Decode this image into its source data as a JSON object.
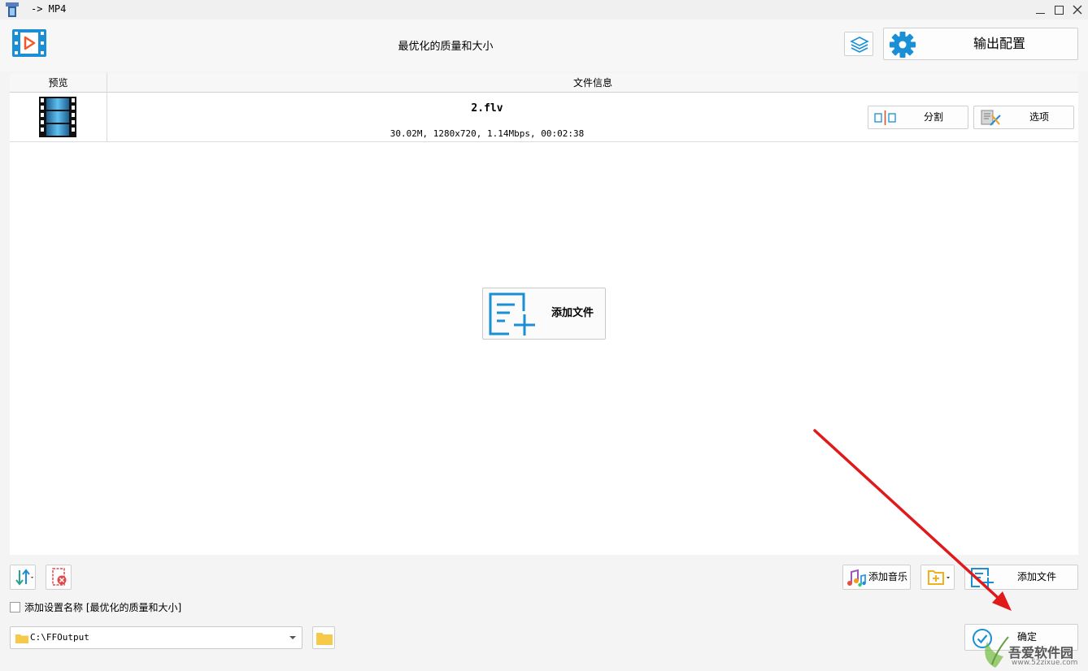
{
  "window": {
    "title": "-> MP4",
    "minimize_glyph": "—",
    "maximize_glyph": "☐",
    "close_glyph": "✕"
  },
  "toolbar": {
    "preset_title": "最优化的质量和大小",
    "output_config_label": "输出配置"
  },
  "table": {
    "columns": [
      "预览",
      "文件信息"
    ],
    "rows": [
      {
        "filename": "2.flv",
        "info": "30.02M, 1280x720, 1.14Mbps, 00:02:38",
        "split_label": "分割",
        "options_label": "选项"
      }
    ]
  },
  "center": {
    "add_file_label": "添加文件"
  },
  "bottom": {
    "add_music_label": "添加音乐",
    "add_file_label": "添加文件",
    "checkbox_label": "添加设置名称 [最优化的质量和大小]",
    "checkbox_checked": false,
    "output_path": "C:\\FFOutput",
    "ok_label": "确定"
  },
  "watermark": {
    "site_name": "吾爱软件园",
    "site_url": "www.52zixue.com"
  },
  "colors": {
    "accent_blue": "#1a8fd6",
    "arrow_red": "#e0191b",
    "folder_yellow": "#f7c948"
  },
  "icons": {
    "app": "video-play-icon",
    "layers": "layers-icon",
    "gear": "gear-icon",
    "film": "film-strip-icon",
    "split": "split-icon",
    "options": "options-icon",
    "add_file": "add-file-icon",
    "sort": "sort-icon",
    "delete": "delete-icon",
    "music": "music-icon",
    "add_folder": "add-folder-icon",
    "folder": "folder-icon",
    "check": "check-circle-icon"
  }
}
